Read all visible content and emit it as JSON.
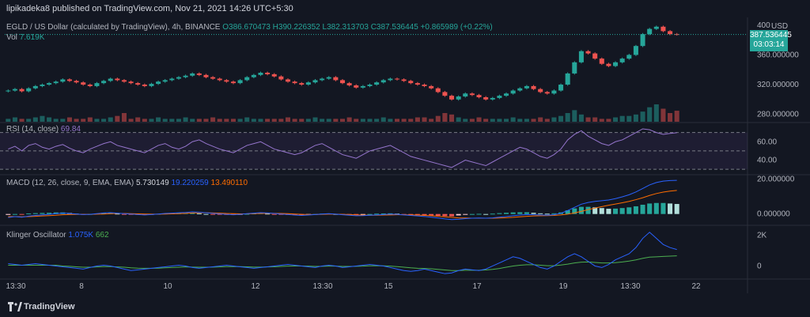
{
  "header": {
    "published": "lipikadeka8 published on TradingView.com, Nov 21, 2021 14:26 UTC+5:30"
  },
  "main_legend": {
    "symbol": "EGLD / US Dollar (calculated by TradingView), 4h, BINANCE",
    "o": "O386.670473",
    "h": "H390.226352",
    "l": "L382.313703",
    "c": "C387.536445",
    "chg": "+0.865989 (+0.22%)",
    "vol_label": "Vol",
    "vol_value": "7.619K"
  },
  "price_axis": {
    "currency": "USD",
    "ticks": [
      "400",
      "360.000000",
      "320.000000",
      "280.000000"
    ],
    "last_price": "387.536445",
    "countdown": "03:03:14"
  },
  "rsi": {
    "label": "RSI (14, close)",
    "value": "69.84",
    "ticks": [
      "60.00",
      "40.00"
    ]
  },
  "macd": {
    "label": "MACD (12, 26, close, 9, EMA, EMA)",
    "hist": "5.730149",
    "macd": "19.220259",
    "signal": "13.490110",
    "ticks": [
      "20.000000",
      "0.000000"
    ]
  },
  "klinger": {
    "label": "Klinger Oscillator",
    "value": "1.075K",
    "signal": "662",
    "ticks": [
      "2K",
      "0"
    ]
  },
  "time_axis": {
    "labels": [
      "13:30",
      "8",
      "10",
      "12",
      "13:30",
      "15",
      "17",
      "19",
      "13:30",
      "22"
    ]
  },
  "footer": {
    "brand": "TradingView"
  },
  "colors": {
    "up": "#26a69a",
    "down": "#ef5350",
    "rsi": "#9575cd",
    "macd": "#2962ff",
    "signal": "#ff6d00",
    "klinger": "#2962ff",
    "klinger_signal": "#4caf50"
  },
  "chart_data": {
    "type": "line",
    "title": "EGLD / US Dollar (calculated by TradingView), 4h, BINANCE",
    "xlabel": "",
    "ylabel": "USD",
    "ylim": [
      270,
      402
    ],
    "x": [
      "13:30",
      "8",
      "10",
      "12",
      "13:30",
      "15",
      "17",
      "19",
      "13:30",
      "22"
    ],
    "candles_close": [
      312,
      314,
      311,
      315,
      318,
      320,
      322,
      324,
      327,
      325,
      323,
      320,
      318,
      322,
      325,
      328,
      326,
      324,
      322,
      320,
      318,
      321,
      324,
      326,
      328,
      330,
      332,
      335,
      333,
      330,
      328,
      326,
      324,
      322,
      326,
      330,
      333,
      336,
      334,
      331,
      327,
      324,
      322,
      320,
      323,
      326,
      328,
      330,
      326,
      322,
      319,
      316,
      318,
      320,
      323,
      326,
      328,
      327,
      325,
      322,
      320,
      318,
      315,
      310,
      305,
      300,
      304,
      308,
      306,
      303,
      300,
      302,
      305,
      308,
      312,
      315,
      318,
      314,
      310,
      308,
      312,
      320,
      335,
      350,
      365,
      362,
      355,
      348,
      345,
      350,
      355,
      360,
      372,
      388,
      395,
      398,
      392,
      388,
      387.5
    ],
    "volume": [
      2,
      3,
      2,
      2,
      3,
      4,
      3,
      2,
      2,
      3,
      2,
      2,
      3,
      2,
      2,
      3,
      4,
      6,
      2,
      3,
      2,
      2,
      3,
      2,
      2,
      2,
      3,
      2,
      2,
      2,
      3,
      2,
      2,
      2,
      2,
      3,
      2,
      2,
      2,
      2,
      2,
      3,
      2,
      2,
      2,
      3,
      2,
      2,
      2,
      2,
      3,
      2,
      2,
      2,
      2,
      3,
      2,
      2,
      2,
      2,
      3,
      3,
      2,
      4,
      6,
      5,
      3,
      2,
      2,
      3,
      2,
      2,
      2,
      2,
      3,
      2,
      2,
      2,
      3,
      2,
      3,
      4,
      6,
      8,
      5,
      3,
      3,
      2,
      2,
      3,
      4,
      4,
      5,
      7,
      10,
      12,
      9,
      6,
      7.6
    ],
    "rsi": [
      52,
      55,
      50,
      56,
      58,
      54,
      52,
      55,
      57,
      53,
      50,
      48,
      52,
      55,
      58,
      60,
      56,
      54,
      52,
      50,
      48,
      52,
      56,
      58,
      54,
      52,
      55,
      60,
      62,
      58,
      55,
      52,
      50,
      48,
      52,
      56,
      58,
      60,
      56,
      52,
      50,
      48,
      46,
      48,
      52,
      56,
      58,
      54,
      50,
      46,
      44,
      42,
      46,
      50,
      52,
      54,
      56,
      52,
      48,
      44,
      42,
      40,
      38,
      36,
      34,
      32,
      36,
      40,
      38,
      36,
      34,
      38,
      42,
      46,
      50,
      54,
      52,
      48,
      44,
      42,
      46,
      52,
      62,
      68,
      72,
      66,
      62,
      58,
      56,
      60,
      62,
      66,
      70,
      74,
      73,
      70,
      68,
      69,
      69.84
    ],
    "macd": [
      -2,
      -1.5,
      -1.8,
      -1.2,
      -0.8,
      -0.5,
      -0.2,
      0.2,
      0.5,
      0.3,
      0,
      -0.3,
      -0.2,
      0.2,
      0.6,
      0.8,
      0.5,
      0.2,
      0,
      -0.3,
      -0.5,
      -0.3,
      0,
      0.3,
      0.5,
      0.7,
      0.9,
      1.2,
      1.0,
      0.7,
      0.4,
      0.1,
      -0.2,
      -0.4,
      -0.2,
      0.2,
      0.5,
      0.8,
      0.6,
      0.3,
      0,
      -0.3,
      -0.6,
      -0.8,
      -0.6,
      -0.3,
      0,
      0.2,
      -0.1,
      -0.4,
      -0.7,
      -1,
      -0.9,
      -0.7,
      -0.5,
      -0.3,
      -0.1,
      -0.2,
      -0.5,
      -0.8,
      -1.1,
      -1.4,
      -1.8,
      -2.3,
      -2.8,
      -3.2,
      -3,
      -2.6,
      -2.4,
      -2.3,
      -2.4,
      -2.2,
      -1.8,
      -1.4,
      -1,
      -0.6,
      -0.3,
      -0.4,
      -0.6,
      -0.7,
      -0.4,
      0.4,
      2,
      3.8,
      5.6,
      6.6,
      7.2,
      7.6,
      8,
      8.8,
      9.8,
      11,
      12.6,
      14.6,
      16.6,
      18,
      18.8,
      19.1,
      19.22
    ],
    "signal": [
      -1.5,
      -1.5,
      -1.6,
      -1.5,
      -1.3,
      -1.1,
      -0.9,
      -0.7,
      -0.4,
      -0.3,
      -0.2,
      -0.2,
      -0.2,
      -0.1,
      0,
      0.2,
      0.3,
      0.3,
      0.2,
      0.1,
      0,
      -0.1,
      -0.1,
      0,
      0.1,
      0.2,
      0.4,
      0.6,
      0.7,
      0.7,
      0.6,
      0.5,
      0.3,
      0.2,
      0.1,
      0.1,
      0.2,
      0.3,
      0.4,
      0.4,
      0.3,
      0.2,
      0,
      -0.2,
      -0.3,
      -0.3,
      -0.2,
      -0.1,
      -0.1,
      -0.2,
      -0.3,
      -0.5,
      -0.6,
      -0.7,
      -0.7,
      -0.6,
      -0.5,
      -0.4,
      -0.4,
      -0.5,
      -0.6,
      -0.8,
      -1,
      -1.3,
      -1.6,
      -1.9,
      -2.2,
      -2.3,
      -2.4,
      -2.4,
      -2.4,
      -2.4,
      -2.3,
      -2.1,
      -1.9,
      -1.6,
      -1.3,
      -1.1,
      -1,
      -0.9,
      -0.8,
      -0.5,
      -0.1,
      0.6,
      1.5,
      2.5,
      3.4,
      4.2,
      5,
      5.7,
      6.4,
      7.2,
      8.2,
      9.3,
      10.6,
      11.7,
      12.5,
      13.1,
      13.49
    ],
    "klinger": [
      0.15,
      0.1,
      0.05,
      0.1,
      0.15,
      0.1,
      0.05,
      0,
      -0.05,
      -0.1,
      -0.15,
      -0.2,
      -0.1,
      0,
      0.05,
      0,
      -0.1,
      -0.2,
      -0.3,
      -0.25,
      -0.2,
      -0.15,
      -0.1,
      -0.05,
      0,
      0.05,
      0,
      -0.1,
      -0.15,
      -0.1,
      -0.05,
      0,
      0.05,
      0,
      -0.05,
      -0.1,
      -0.15,
      -0.1,
      -0.05,
      0,
      0.05,
      0.1,
      0.05,
      0,
      -0.05,
      -0.1,
      0,
      0.05,
      0,
      -0.1,
      -0.05,
      0,
      0.05,
      0.1,
      0.05,
      0,
      -0.1,
      -0.2,
      -0.3,
      -0.35,
      -0.3,
      -0.2,
      -0.3,
      -0.4,
      -0.5,
      -0.45,
      -0.3,
      -0.2,
      -0.25,
      -0.3,
      -0.2,
      0,
      0.2,
      0.4,
      0.6,
      0.5,
      0.3,
      0.1,
      -0.1,
      -0.2,
      0,
      0.3,
      0.6,
      0.8,
      0.6,
      0.3,
      0,
      -0.1,
      0.1,
      0.4,
      0.6,
      0.8,
      1.2,
      1.8,
      2.2,
      1.8,
      1.4,
      1.2,
      1.075
    ],
    "klinger_signal": [
      0.05,
      0.05,
      0.05,
      0.05,
      0.05,
      0.05,
      0.05,
      0.05,
      0,
      -0.02,
      -0.05,
      -0.08,
      -0.08,
      -0.06,
      -0.04,
      -0.04,
      -0.06,
      -0.08,
      -0.12,
      -0.14,
      -0.15,
      -0.15,
      -0.14,
      -0.12,
      -0.1,
      -0.08,
      -0.06,
      -0.07,
      -0.08,
      -0.08,
      -0.07,
      -0.06,
      -0.04,
      -0.04,
      -0.04,
      -0.05,
      -0.07,
      -0.07,
      -0.06,
      -0.05,
      -0.03,
      -0.01,
      0,
      0,
      -0.01,
      -0.03,
      -0.02,
      -0.01,
      -0.01,
      -0.03,
      -0.03,
      -0.02,
      -0.01,
      0.01,
      0.02,
      0.01,
      -0.01,
      -0.04,
      -0.08,
      -0.12,
      -0.15,
      -0.16,
      -0.18,
      -0.22,
      -0.26,
      -0.3,
      -0.3,
      -0.28,
      -0.28,
      -0.28,
      -0.26,
      -0.22,
      -0.16,
      -0.08,
      0,
      0.05,
      0.08,
      0.08,
      0.05,
      0.02,
      0.02,
      0.06,
      0.12,
      0.2,
      0.25,
      0.26,
      0.23,
      0.2,
      0.2,
      0.22,
      0.26,
      0.32,
      0.4,
      0.5,
      0.58,
      0.6,
      0.62,
      0.64,
      0.662
    ]
  }
}
